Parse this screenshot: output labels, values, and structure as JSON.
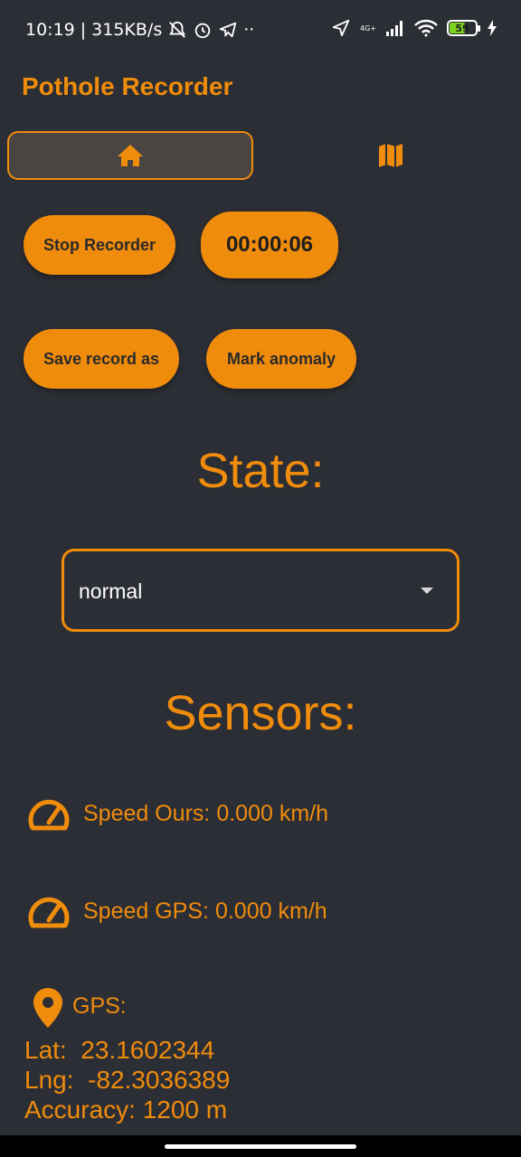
{
  "status_bar": {
    "time": "10:19",
    "speed": "315KB/s",
    "network": "4G+",
    "battery": "59"
  },
  "app": {
    "title": "Pothole Recorder"
  },
  "tabs": [
    {
      "icon": "home-icon",
      "selected": true
    },
    {
      "icon": "map-icon",
      "selected": false
    }
  ],
  "controls": {
    "stop_label": "Stop Recorder",
    "timer": "00:00:06",
    "save_label": "Save record as",
    "mark_label": "Mark anomaly"
  },
  "state": {
    "heading": "State:",
    "selected": "normal"
  },
  "sensors": {
    "heading": "Sensors:",
    "speed_ours": {
      "label": "Speed Ours:",
      "value": "0.000",
      "unit": "km/h"
    },
    "speed_gps": {
      "label": "Speed GPS:",
      "value": "0.000",
      "unit": "km/h"
    },
    "gps": {
      "label": "GPS:",
      "lat_label": "Lat:",
      "lat": "23.1602344",
      "lng_label": "Lng:",
      "lng": "-82.3036389",
      "accuracy_label": "Accuracy:",
      "accuracy": "1200 m"
    }
  },
  "colors": {
    "accent": "#f08c0c",
    "background": "#2c2e35",
    "tab_selected": "#4a4543"
  }
}
